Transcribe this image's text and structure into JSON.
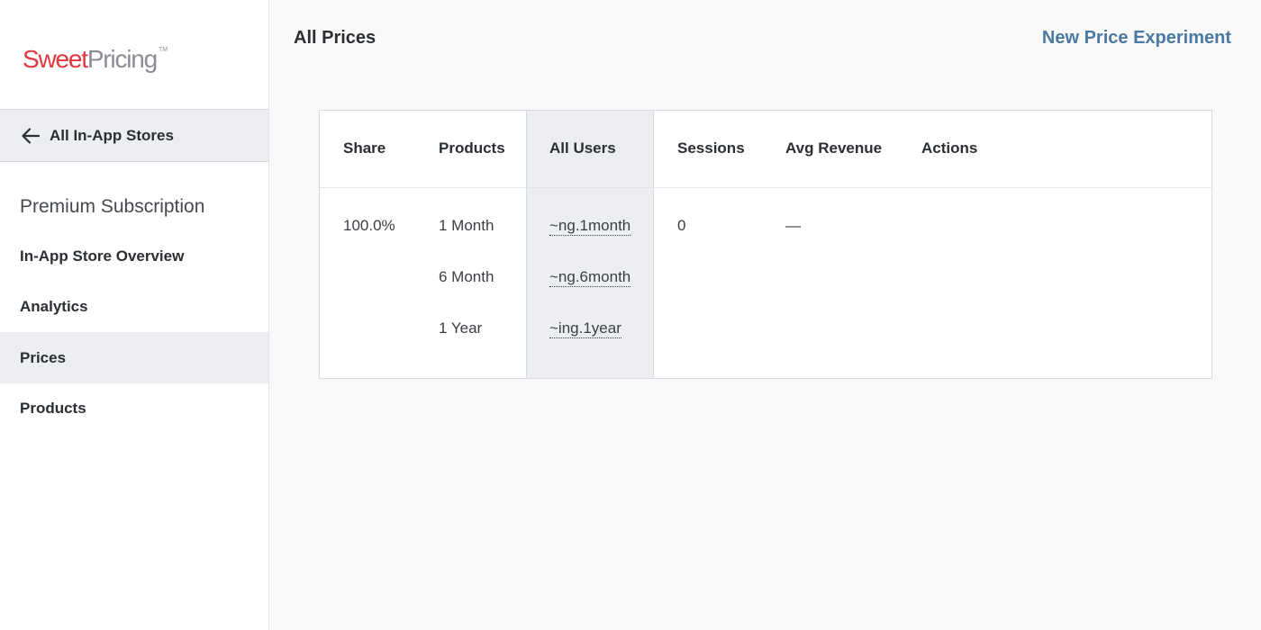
{
  "brand": {
    "logo_part1": "Sweet",
    "logo_part2": "Pricing",
    "trademark": "TM",
    "accent_color": "#e2373f"
  },
  "sidebar": {
    "back_label": "All In-App Stores",
    "section_title": "Premium Subscription",
    "items": [
      {
        "label": "In-App Store Overview",
        "active": false
      },
      {
        "label": "Analytics",
        "active": false
      },
      {
        "label": "Prices",
        "active": true
      },
      {
        "label": "Products",
        "active": false
      }
    ]
  },
  "header": {
    "title": "All Prices",
    "action_label": "New Price Experiment"
  },
  "table": {
    "columns": [
      "Share",
      "Products",
      "All Users",
      "Sessions",
      "Avg Revenue",
      "Actions"
    ],
    "share": "100.0%",
    "products": [
      "1 Month",
      "6 Month",
      "1 Year"
    ],
    "product_ids": [
      "~ng.1month",
      "~ng.6month",
      "~ing.1year"
    ],
    "sessions": "0",
    "avg_revenue": "—"
  }
}
